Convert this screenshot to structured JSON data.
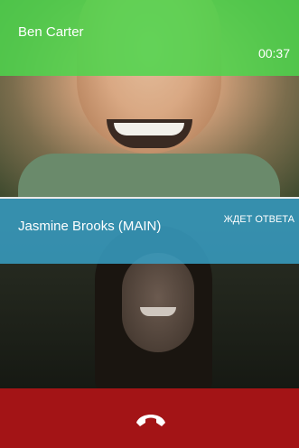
{
  "calls": {
    "active": {
      "caller_name": "Ben Carter",
      "duration": "00:37"
    },
    "second": {
      "caller_name": "Jasmine Brooks   (MAIN)",
      "status": "ЖДЕТ ОТВЕТА"
    }
  },
  "end_call": {
    "icon": "hangup-icon"
  },
  "colors": {
    "active_bar": "#4cd64c",
    "second_bar": "#38a0c6",
    "end_call_bg": "#a31416"
  }
}
